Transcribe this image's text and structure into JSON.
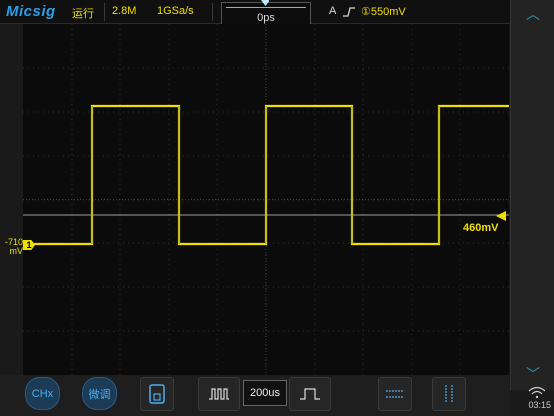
{
  "topbar": {
    "logo": "Micsig",
    "run_status": "运行",
    "memory_depth": "2.8M",
    "sample_rate": "1GSa/s",
    "horizontal_delay": "0ps"
  },
  "trigger": {
    "mode": "A",
    "slope_symbol": "∫",
    "source_and_level": "①550mV"
  },
  "channel1": {
    "label": "1",
    "offset_value": "-710",
    "offset_unit": "mV",
    "trigger_level_readout": "460mV",
    "color": "#f0e000"
  },
  "bottombar": {
    "chx_label": "CHx",
    "fine_label": "微调",
    "timebase": "200us"
  },
  "system": {
    "clock": "03:15"
  },
  "colors": {
    "accent": "#2c9ee8",
    "trace": "#f0e000",
    "grid": "#2e2e2e"
  }
}
